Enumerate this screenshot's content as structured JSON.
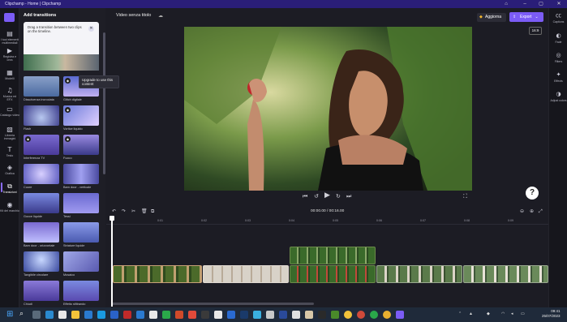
{
  "window": {
    "title": "Clipchamp - Home | Clipchamp"
  },
  "left_nav": [
    {
      "label": "I tuoi elementi multimediali",
      "icon": "media-icon"
    },
    {
      "label": "Registra e crea",
      "icon": "record-icon"
    },
    {
      "label": "Modelli",
      "icon": "templates-icon"
    },
    {
      "label": "Musica ed EFX",
      "icon": "music-icon"
    },
    {
      "label": "Catalogo video",
      "icon": "video-catalog-icon"
    },
    {
      "label": "Libreria immagini",
      "icon": "image-library-icon"
    },
    {
      "label": "Testo",
      "icon": "text-icon"
    },
    {
      "label": "Grafica",
      "icon": "graphics-icon"
    },
    {
      "label": "Transizioni",
      "icon": "transitions-icon",
      "active": true
    },
    {
      "label": "Kit del marchio",
      "icon": "brand-kit-icon"
    }
  ],
  "panel": {
    "title": "Add transitions",
    "tip_text": "Drag a transition between two clips on the timeline.",
    "tooltip": "Upgrade to use this content",
    "transitions": [
      {
        "label": "Dissolvenza incrociata",
        "premium": false
      },
      {
        "label": "Glitch digitale",
        "premium": true
      },
      {
        "label": "Flash",
        "premium": false
      },
      {
        "label": "Vortice liquido",
        "premium": true
      },
      {
        "label": "Interferenza TV",
        "premium": true
      },
      {
        "label": "Fuoco",
        "premium": true
      },
      {
        "label": "Cuore",
        "premium": false
      },
      {
        "label": "Barn door - verticale",
        "premium": false
      },
      {
        "label": "Gocce liquide",
        "premium": false
      },
      {
        "label": "Tessi",
        "premium": false
      },
      {
        "label": "Barn door - orizzontale",
        "premium": false
      },
      {
        "label": "Striature liquide",
        "premium": false
      },
      {
        "label": "Tangibile circolare",
        "premium": false
      },
      {
        "label": "Mosaico",
        "premium": false
      },
      {
        "label": "Chiudi",
        "premium": false
      },
      {
        "label": "Effetto sfiltrando",
        "premium": false
      }
    ]
  },
  "topbar": {
    "video_name": "Video senza titolo",
    "upgrade_label": "Aggiorna",
    "export_label": "Export"
  },
  "preview": {
    "aspect_ratio": "16:9",
    "help": "?"
  },
  "timeline": {
    "timecode": "00:00.00 / 00:16.00",
    "ticks": [
      "0",
      "0:01",
      "0:02",
      "0:03",
      "0:04",
      "0:05",
      "0:06",
      "0:07",
      "0:08",
      "0:09"
    ]
  },
  "right_nav": [
    {
      "label": "Captions",
      "icon": "captions-icon"
    },
    {
      "label": "Fade",
      "icon": "fade-icon"
    },
    {
      "label": "Filters",
      "icon": "filters-icon"
    },
    {
      "label": "Effects",
      "icon": "effects-icon"
    },
    {
      "label": "Adjust colors",
      "icon": "adjust-colors-icon"
    }
  ],
  "taskbar": {
    "time": "09:41",
    "date": "25/07/2023"
  },
  "colors": {
    "accent": "#7b5cf5",
    "titlebar": "#2a1e78",
    "background": "#1c1c24"
  }
}
